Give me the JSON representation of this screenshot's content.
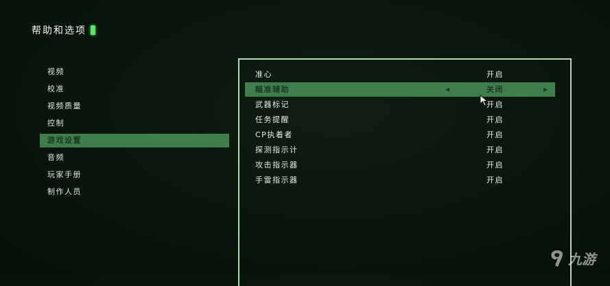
{
  "header": {
    "title": "帮助和选项"
  },
  "sidebar": {
    "items": [
      {
        "label": "视频"
      },
      {
        "label": "校准"
      },
      {
        "label": "视频质量"
      },
      {
        "label": "控制"
      },
      {
        "label": "游戏设置",
        "selected": true
      },
      {
        "label": "音频"
      },
      {
        "label": "玩家手册"
      },
      {
        "label": "制作人员"
      }
    ]
  },
  "settings": {
    "rows": [
      {
        "label": "准心",
        "value": "开启"
      },
      {
        "label": "瞄准辅助",
        "value": "关闭",
        "selected": true
      },
      {
        "label": "武器标记",
        "value": "开启"
      },
      {
        "label": "任务提醒",
        "value": "开启"
      },
      {
        "label": "CP执着者",
        "value": "开启"
      },
      {
        "label": "探测指示计",
        "value": "开启"
      },
      {
        "label": "攻击指示器",
        "value": "开启"
      },
      {
        "label": "手雷指示器",
        "value": "开启"
      }
    ],
    "arrow_left": "◀",
    "arrow_right": "▶"
  },
  "watermark": {
    "text": "九游",
    "logo": "jiuyou-logo-icon"
  },
  "colors": {
    "accent": "#3f7d4c",
    "panel_border": "#b3dcb5",
    "marker": "#5ee06a",
    "background": "#0a150c"
  }
}
